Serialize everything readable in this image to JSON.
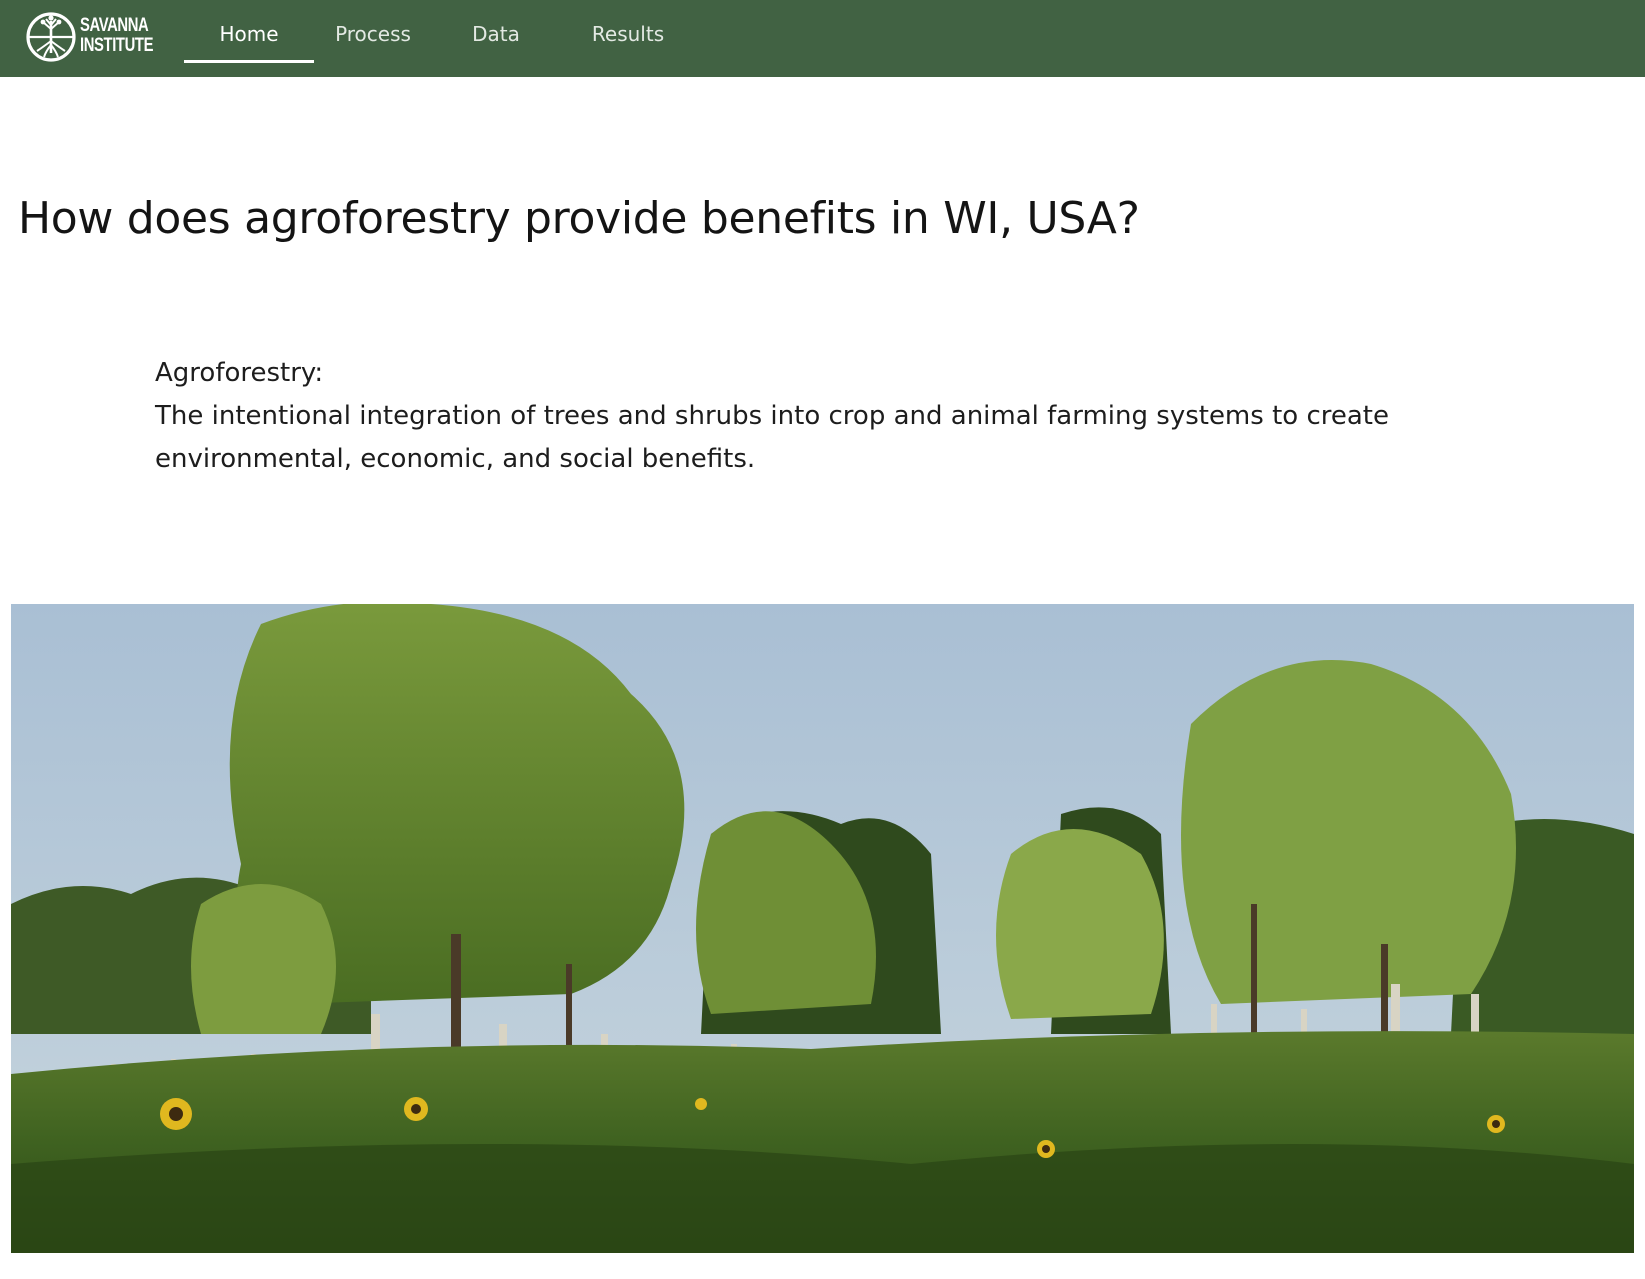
{
  "brand": {
    "logo_lines": [
      "SAVANNA",
      "INSTITUTE"
    ]
  },
  "nav": {
    "items": [
      {
        "label": "Home",
        "active": true
      },
      {
        "label": "Process",
        "active": false
      },
      {
        "label": "Data",
        "active": false
      },
      {
        "label": "Results",
        "active": false
      }
    ]
  },
  "main": {
    "title": "How does agroforestry provide benefits in WI, USA?",
    "definition_term": "Agroforestry:",
    "definition_text": "The intentional integration of trees and shrubs into crop and animal farming systems to create environmental, economic, and social benefits."
  },
  "hero_image": {
    "subject": "Agroforestry field with rows of young trees, tree tubes and sunflowers"
  },
  "colors": {
    "header_bg": "#416243",
    "nav_text": "#e3e9e3",
    "active_underline": "#ffffff",
    "title_text": "#141414"
  }
}
